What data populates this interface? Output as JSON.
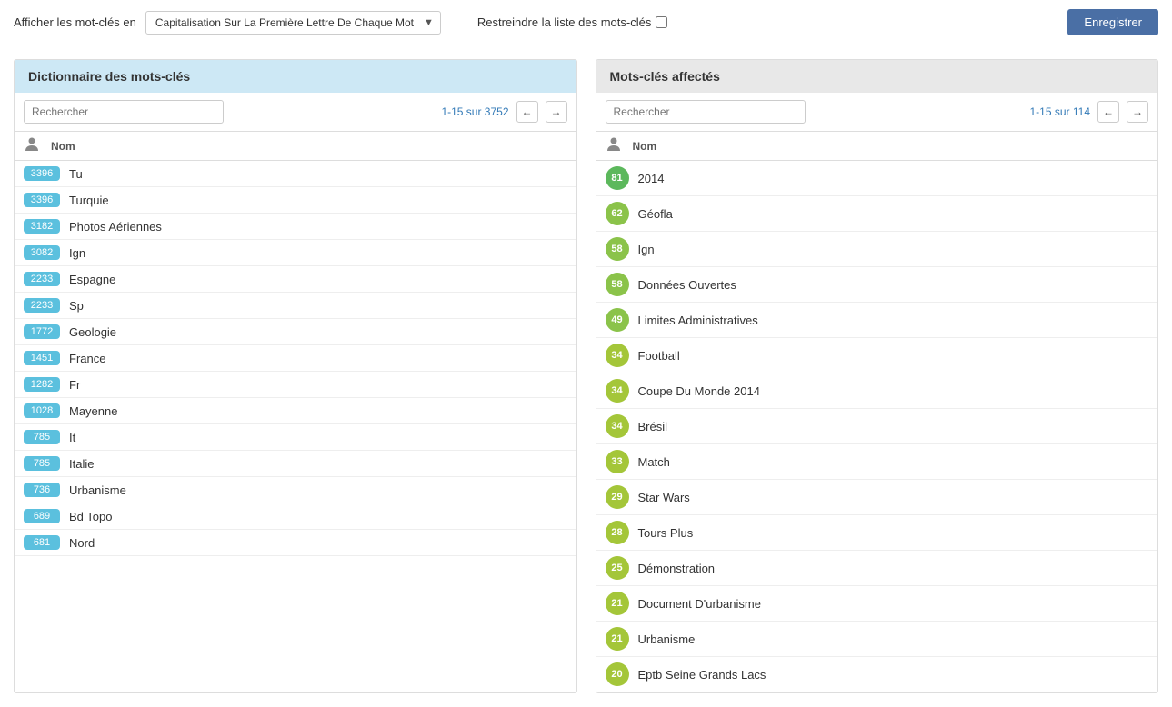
{
  "topbar": {
    "label": "Afficher les mot-clés en",
    "dropdown_value": "Capitalisation Sur La Première Lettre De Chaque Mot",
    "restrict_label": "Restreindre la liste des mots-clés",
    "save_button": "Enregistrer"
  },
  "left_panel": {
    "title": "Dictionnaire des mots-clés",
    "search_placeholder": "Rechercher",
    "pagination": "1-15 sur 3752",
    "col_name": "Nom",
    "rows": [
      {
        "badge": "3396",
        "name": "Tu"
      },
      {
        "badge": "3396",
        "name": "Turquie"
      },
      {
        "badge": "3182",
        "name": "Photos Aériennes"
      },
      {
        "badge": "3082",
        "name": "Ign"
      },
      {
        "badge": "2233",
        "name": "Espagne"
      },
      {
        "badge": "2233",
        "name": "Sp"
      },
      {
        "badge": "1772",
        "name": "Geologie"
      },
      {
        "badge": "1451",
        "name": "France"
      },
      {
        "badge": "1282",
        "name": "Fr"
      },
      {
        "badge": "1028",
        "name": "Mayenne"
      },
      {
        "badge": "785",
        "name": "It"
      },
      {
        "badge": "785",
        "name": "Italie"
      },
      {
        "badge": "736",
        "name": "Urbanisme"
      },
      {
        "badge": "689",
        "name": "Bd Topo"
      },
      {
        "badge": "681",
        "name": "Nord"
      }
    ]
  },
  "right_panel": {
    "title": "Mots-clés affectés",
    "search_placeholder": "Rechercher",
    "pagination": "1-15 sur 114",
    "col_name": "Nom",
    "rows": [
      {
        "badge": "81",
        "name": "2014",
        "color": "#5cb85c"
      },
      {
        "badge": "62",
        "name": "Géofla",
        "color": "#8bc34a"
      },
      {
        "badge": "58",
        "name": "Ign",
        "color": "#8bc34a"
      },
      {
        "badge": "58",
        "name": "Données Ouvertes",
        "color": "#8bc34a"
      },
      {
        "badge": "49",
        "name": "Limites Administratives",
        "color": "#8bc34a"
      },
      {
        "badge": "34",
        "name": "Football",
        "color": "#a4c639"
      },
      {
        "badge": "34",
        "name": "Coupe Du Monde 2014",
        "color": "#a4c639"
      },
      {
        "badge": "34",
        "name": "Brésil",
        "color": "#a4c639"
      },
      {
        "badge": "33",
        "name": "Match",
        "color": "#a4c639"
      },
      {
        "badge": "29",
        "name": "Star Wars",
        "color": "#a4c639"
      },
      {
        "badge": "28",
        "name": "Tours Plus",
        "color": "#a4c639"
      },
      {
        "badge": "25",
        "name": "Démonstration",
        "color": "#a4c639"
      },
      {
        "badge": "21",
        "name": "Document D'urbanisme",
        "color": "#a4c639"
      },
      {
        "badge": "21",
        "name": "Urbanisme",
        "color": "#a4c639"
      },
      {
        "badge": "20",
        "name": "Eptb Seine Grands Lacs",
        "color": "#a4c639"
      }
    ]
  }
}
